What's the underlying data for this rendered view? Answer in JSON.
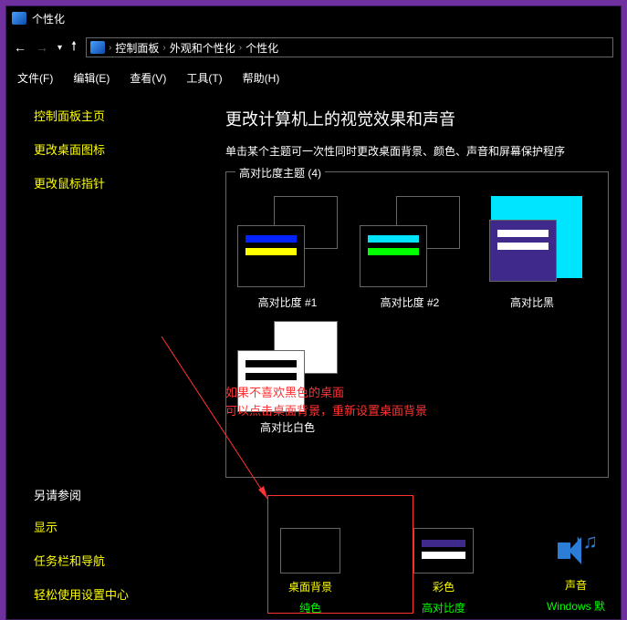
{
  "window": {
    "title": "个性化"
  },
  "nav": {
    "breadcrumbs": [
      "控制面板",
      "外观和个性化",
      "个性化"
    ]
  },
  "menubar": [
    "文件(F)",
    "编辑(E)",
    "查看(V)",
    "工具(T)",
    "帮助(H)"
  ],
  "sidebar": {
    "links": [
      "控制面板主页",
      "更改桌面图标",
      "更改鼠标指针"
    ],
    "seealso_head": "另请参阅",
    "seealso": [
      "显示",
      "任务栏和导航",
      "轻松使用设置中心"
    ]
  },
  "main": {
    "heading": "更改计算机上的视觉效果和声音",
    "sub": "单击某个主题可一次性同时更改桌面背景、颜色、声音和屏幕保护程序",
    "section": "高对比度主题 (4)",
    "themes": [
      {
        "label": "高对比度 #1",
        "bars": [
          "#0023ff",
          "#ffff00"
        ],
        "back": "#000000"
      },
      {
        "label": "高对比度 #2",
        "bars": [
          "#00e5ff",
          "#00ff00"
        ],
        "back": "#000000"
      },
      {
        "label": "高对比黑",
        "bars": [
          "#ffffff",
          "#ffffff"
        ],
        "back": "#00e5ff",
        "selected": true
      },
      {
        "label": "高对比白色",
        "bars": [
          "#000000",
          "#000000"
        ],
        "back": "#ffffff"
      }
    ]
  },
  "bottom": [
    {
      "title": "桌面背景",
      "sub": "纯色",
      "bars": []
    },
    {
      "title": "彩色",
      "sub": "高对比度",
      "bars": [
        "#3f2a8c",
        "#ffffff"
      ]
    },
    {
      "title": "声音",
      "sub": "Windows 默",
      "icon": "sound"
    }
  ],
  "annotation": {
    "line1": "如果不喜欢黑色的桌面",
    "line2": "可以点击桌面背景，重新设置桌面背景"
  }
}
